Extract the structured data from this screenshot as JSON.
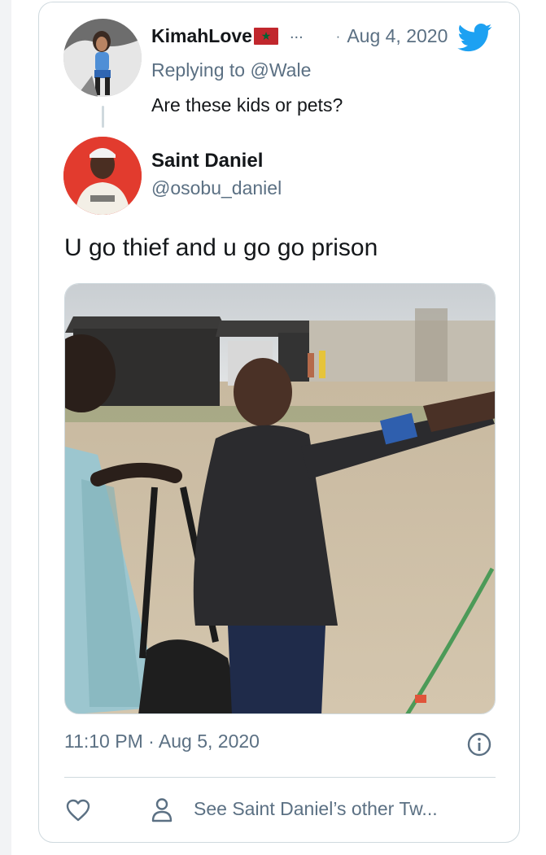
{
  "parent_tweet": {
    "author_name": "KimahLove",
    "author_flag_icon": "morocco-flag-icon",
    "ellipsis": "...",
    "date_separator": "·",
    "date": "Aug 4, 2020",
    "replying_prefix": "Replying to ",
    "replying_to": "@Wale",
    "text": "Are these kids or pets?"
  },
  "main_tweet": {
    "author_name": "Saint Daniel",
    "handle": "@osobu_daniel",
    "text": "U go thief and u go go prison",
    "media_type": "video",
    "timestamp": "11:10 PM · Aug 5, 2020"
  },
  "actions": {
    "like_icon": "heart-icon",
    "profile_icon": "person-icon",
    "other_tweets_label": "See Saint Daniel’s other Tw..."
  },
  "colors": {
    "twitter_blue": "#1da1f2",
    "secondary_text": "#5b7083",
    "border": "#cfd9de",
    "primary_text": "#14171a"
  }
}
